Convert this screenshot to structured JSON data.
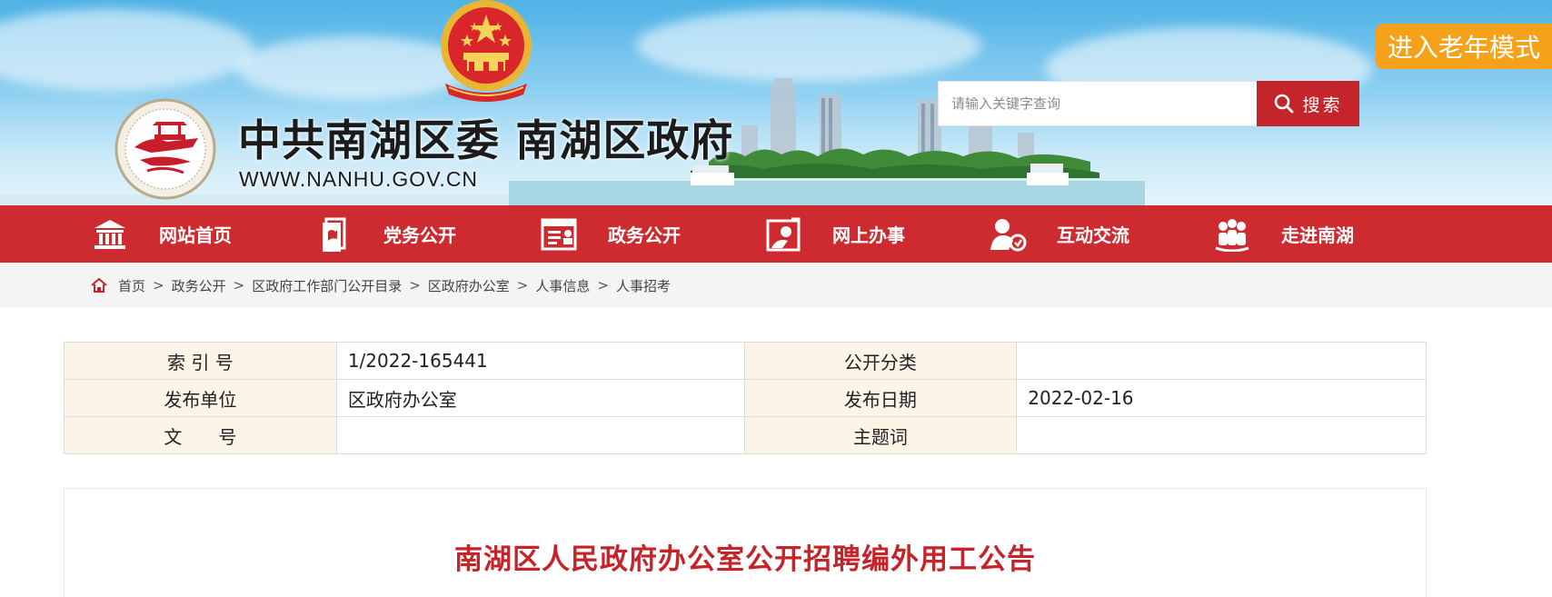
{
  "header": {
    "title": "中共南湖区委 南湖区政府",
    "url": "WWW.NANHU.GOV.CN",
    "search_placeholder": "请输入关键字查询",
    "search_button": "搜索",
    "elder_mode": "进入老年模式"
  },
  "nav": {
    "items": [
      {
        "label": "网站首页",
        "icon": "museum-icon"
      },
      {
        "label": "党务公开",
        "icon": "party-flag-icon"
      },
      {
        "label": "政务公开",
        "icon": "id-card-icon"
      },
      {
        "label": "网上办事",
        "icon": "online-service-icon"
      },
      {
        "label": "互动交流",
        "icon": "interaction-icon"
      },
      {
        "label": "走进南湖",
        "icon": "people-group-icon"
      }
    ]
  },
  "breadcrumb": {
    "items": [
      "首页",
      "政务公开",
      "区政府工作部门公开目录",
      "区政府办公室",
      "人事信息",
      "人事招考"
    ],
    "separator": ">"
  },
  "meta": {
    "rows": [
      {
        "k1": "索 引 号",
        "v1": "1/2022-165441",
        "k2": "公开分类",
        "v2": ""
      },
      {
        "k1": "发布单位",
        "v1": "区政府办公室",
        "k2": "发布日期",
        "v2": "2022-02-16"
      },
      {
        "k1": "文　　号",
        "v1": "",
        "k2": "主题词",
        "v2": ""
      }
    ]
  },
  "article": {
    "title": "南湖区人民政府办公室公开招聘编外用工公告"
  },
  "colors": {
    "nav_red": "#cd2b2f",
    "title_red": "#c4252a",
    "elder_orange": "#f5a21a",
    "table_key_bg": "#fdf4e8"
  }
}
